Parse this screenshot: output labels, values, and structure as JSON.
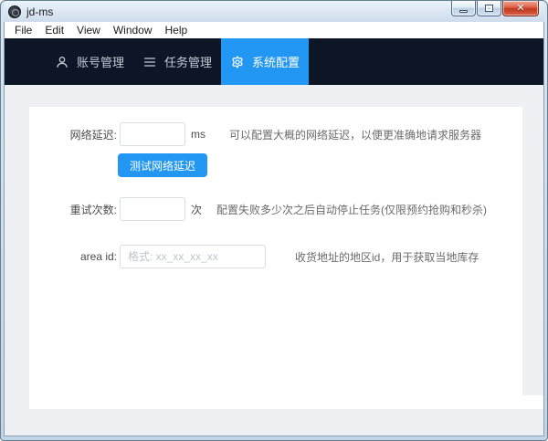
{
  "window": {
    "title": "jd-ms"
  },
  "menu": {
    "items": [
      "File",
      "Edit",
      "View",
      "Window",
      "Help"
    ]
  },
  "nav": {
    "tabs": [
      {
        "label": "账号管理",
        "icon": "user-icon",
        "active": false
      },
      {
        "label": "任务管理",
        "icon": "list-icon",
        "active": false
      },
      {
        "label": "系统配置",
        "icon": "gear-icon",
        "active": true
      }
    ]
  },
  "form": {
    "network_delay": {
      "label": "网络延迟:",
      "value": "",
      "unit": "ms",
      "hint": "可以配置大概的网络延迟，以便更准确地请求服务器"
    },
    "test_network_button": "测试网络延迟",
    "retry_count": {
      "label": "重试次数:",
      "value": "",
      "unit": "次",
      "hint": "配置失败多少次之后自动停止任务(仅限预约抢购和秒杀)"
    },
    "area_id": {
      "label": "area id:",
      "value": "",
      "placeholder": "格式: xx_xx_xx_xx",
      "hint": "收货地址的地区id，用于获取当地库存"
    }
  },
  "icons": {
    "app": "app-logo-icon",
    "minimize": "minimize-icon",
    "maximize": "maximize-icon",
    "close": "close-icon"
  },
  "glyphs": {
    "close": "✕"
  },
  "colors": {
    "nav_background": "#0d1626",
    "accent_blue": "#2196f3",
    "content_background": "#eef0f3",
    "card_background": "#ffffff"
  }
}
